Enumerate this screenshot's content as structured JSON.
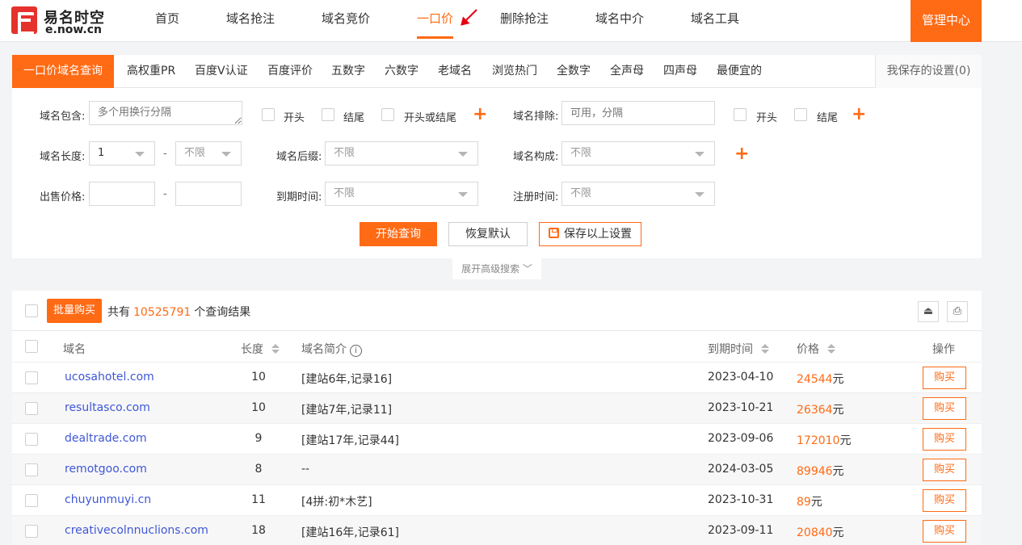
{
  "logo": {
    "cn": "易名时空",
    "en": "e.now.cn"
  },
  "nav": {
    "items": [
      {
        "label": "首页"
      },
      {
        "label": "域名抢注"
      },
      {
        "label": "域名竞价"
      },
      {
        "label": "一口价"
      },
      {
        "label": "删除抢注"
      },
      {
        "label": "域名中介"
      },
      {
        "label": "域名工具"
      }
    ],
    "active": "一口价",
    "admin": "管理中心"
  },
  "tabs": {
    "items": [
      "一口价域名查询",
      "高权重PR",
      "百度V认证",
      "百度评价",
      "五数字",
      "六数字",
      "老域名",
      "浏览热门",
      "全数字",
      "全声母",
      "四声母",
      "最便宜的"
    ],
    "saved": "我保存的设置(0)"
  },
  "filters": {
    "contains_label": "域名包含:",
    "contains_placeholder": "多个用换行分隔",
    "opt_start": "开头",
    "opt_end": "结尾",
    "opt_start_or_end": "开头或结尾",
    "exclude_label": "域名排除:",
    "exclude_placeholder": "可用，分隔",
    "length_label": "域名长度:",
    "length_min": "1",
    "length_max": "不限",
    "suffix_label": "域名后缀:",
    "suffix_value": "不限",
    "composition_label": "域名构成:",
    "composition_value": "不限",
    "price_label": "出售价格:",
    "expire_label": "到期时间:",
    "expire_value": "不限",
    "register_label": "注册时间:",
    "register_value": "不限",
    "range_sep": "-",
    "plus": "+"
  },
  "actions": {
    "search": "开始查询",
    "reset": "恢复默认",
    "save": "保存以上设置",
    "advanced": "展开高级搜索 ﹀"
  },
  "results": {
    "bulk_buy": "批量购买",
    "total_prefix": "共有",
    "total_count": "10525791",
    "total_suffix": "个查询结果",
    "columns": {
      "domain": "域名",
      "length": "长度",
      "desc": "域名简介",
      "expire": "到期时间",
      "price": "价格",
      "action": "操作"
    },
    "currency": "元",
    "buy_label": "购买",
    "rows": [
      {
        "domain": "ucosahotel.com",
        "length": "10",
        "desc": "[建站6年,记录16]",
        "expire": "2023-04-10",
        "price": "24544"
      },
      {
        "domain": "resultasco.com",
        "length": "10",
        "desc": "[建站7年,记录11]",
        "expire": "2023-10-21",
        "price": "26364"
      },
      {
        "domain": "dealtrade.com",
        "length": "9",
        "desc": "[建站17年,记录44]",
        "expire": "2023-09-06",
        "price": "172010"
      },
      {
        "domain": "remotgoo.com",
        "length": "8",
        "desc": "--",
        "expire": "2024-03-05",
        "price": "89946"
      },
      {
        "domain": "chuyunmuyi.cn",
        "length": "11",
        "desc": "[4拼:初*木艺]",
        "expire": "2023-10-31",
        "price": "89"
      },
      {
        "domain": "creativecolnnuclions.com",
        "length": "18",
        "desc": "[建站16年,记录61]",
        "expire": "2023-09-11",
        "price": "20840"
      }
    ]
  },
  "colors": {
    "accent": "#ff6a14",
    "link": "#3f57d6",
    "annotation": "#e60012"
  }
}
